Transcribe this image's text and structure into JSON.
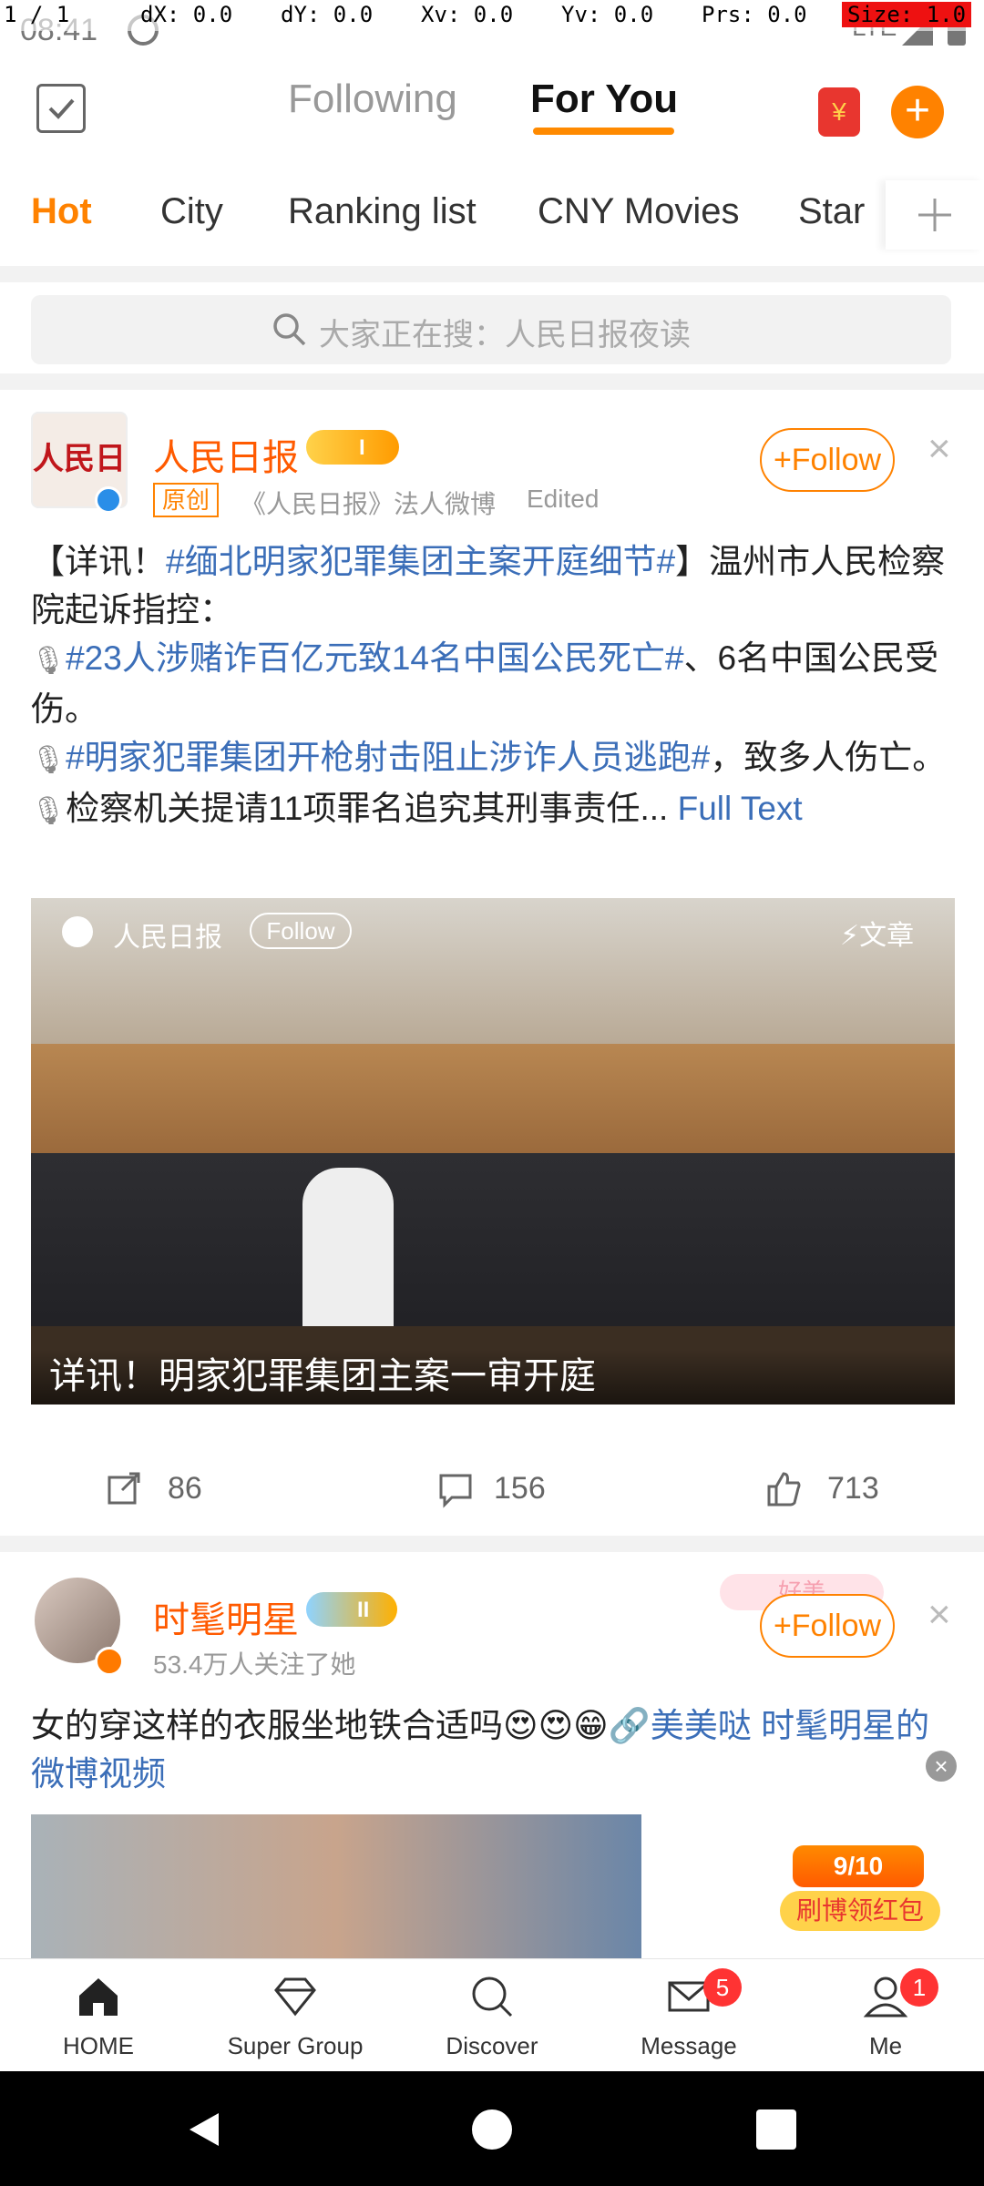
{
  "debug": {
    "pointer": "1 / 1",
    "dx": "dX: 0.0",
    "dy": "dY: 0.0",
    "xv": "Xv: 0.0",
    "yv": "Yv: 0.0",
    "prs": "Prs: 0.0",
    "size": "Size: 1.0"
  },
  "status_bar": {
    "time": "08:41",
    "network": "LTE"
  },
  "top_nav": {
    "tabs": [
      {
        "label": "Following"
      },
      {
        "label": "For You"
      }
    ]
  },
  "channels": [
    {
      "label": "Hot"
    },
    {
      "label": "City"
    },
    {
      "label": "Ranking list"
    },
    {
      "label": "CNY Movies"
    },
    {
      "label": "Star"
    }
  ],
  "search": {
    "placeholder": "大家正在搜：人民日报夜读"
  },
  "post1": {
    "author": "人民日报",
    "level_badge": "I",
    "original_tag": "原创",
    "subtitle": "《人民日报》法人微博",
    "edited": "Edited",
    "follow_label": "+Follow",
    "text_intro": "【详讯！",
    "topic1": "#缅北明家犯罪集团主案开庭细节#",
    "text_after_topic1": "】温州市人民检察院起诉指控：",
    "topic2": "#23人涉赌诈百亿元致14名中国公民死亡#",
    "text_after_topic2": "、6名中国公民受伤。",
    "topic3": "#明家犯罪集团开枪射击阻止涉诈人员逃跑#",
    "text_after_topic3": "，致多人伤亡。",
    "text_last": "检察机关提请11项罪名追究其刑事责任...",
    "full_text": "Full Text",
    "card": {
      "source": "人民日报",
      "follow": "Follow",
      "article": "文章",
      "headline": "详讯！明家犯罪集团主案一审开庭"
    },
    "actions": {
      "repost": "86",
      "comment": "156",
      "like": "713"
    }
  },
  "post2": {
    "author": "时髦明星",
    "level_badge": "II",
    "meta": "53.4万人关注了她",
    "follow_label": "+Follow",
    "text": "女的穿这样的衣服坐地铁合适吗😍😍😁",
    "link1": "🔗美美哒",
    "link2": "时髦明星的微博视频",
    "promo_counter": "9/10",
    "promo_label": "刷博领红包",
    "promo_banner": "好美"
  },
  "bottom_nav": [
    {
      "label": "HOME"
    },
    {
      "label": "Super Group"
    },
    {
      "label": "Discover"
    },
    {
      "label": "Message",
      "badge": "5"
    },
    {
      "label": "Me",
      "badge": "1"
    }
  ],
  "colors": {
    "accent": "#ff8200",
    "topic": "#3b6eb8",
    "badge": "#ff3333"
  }
}
